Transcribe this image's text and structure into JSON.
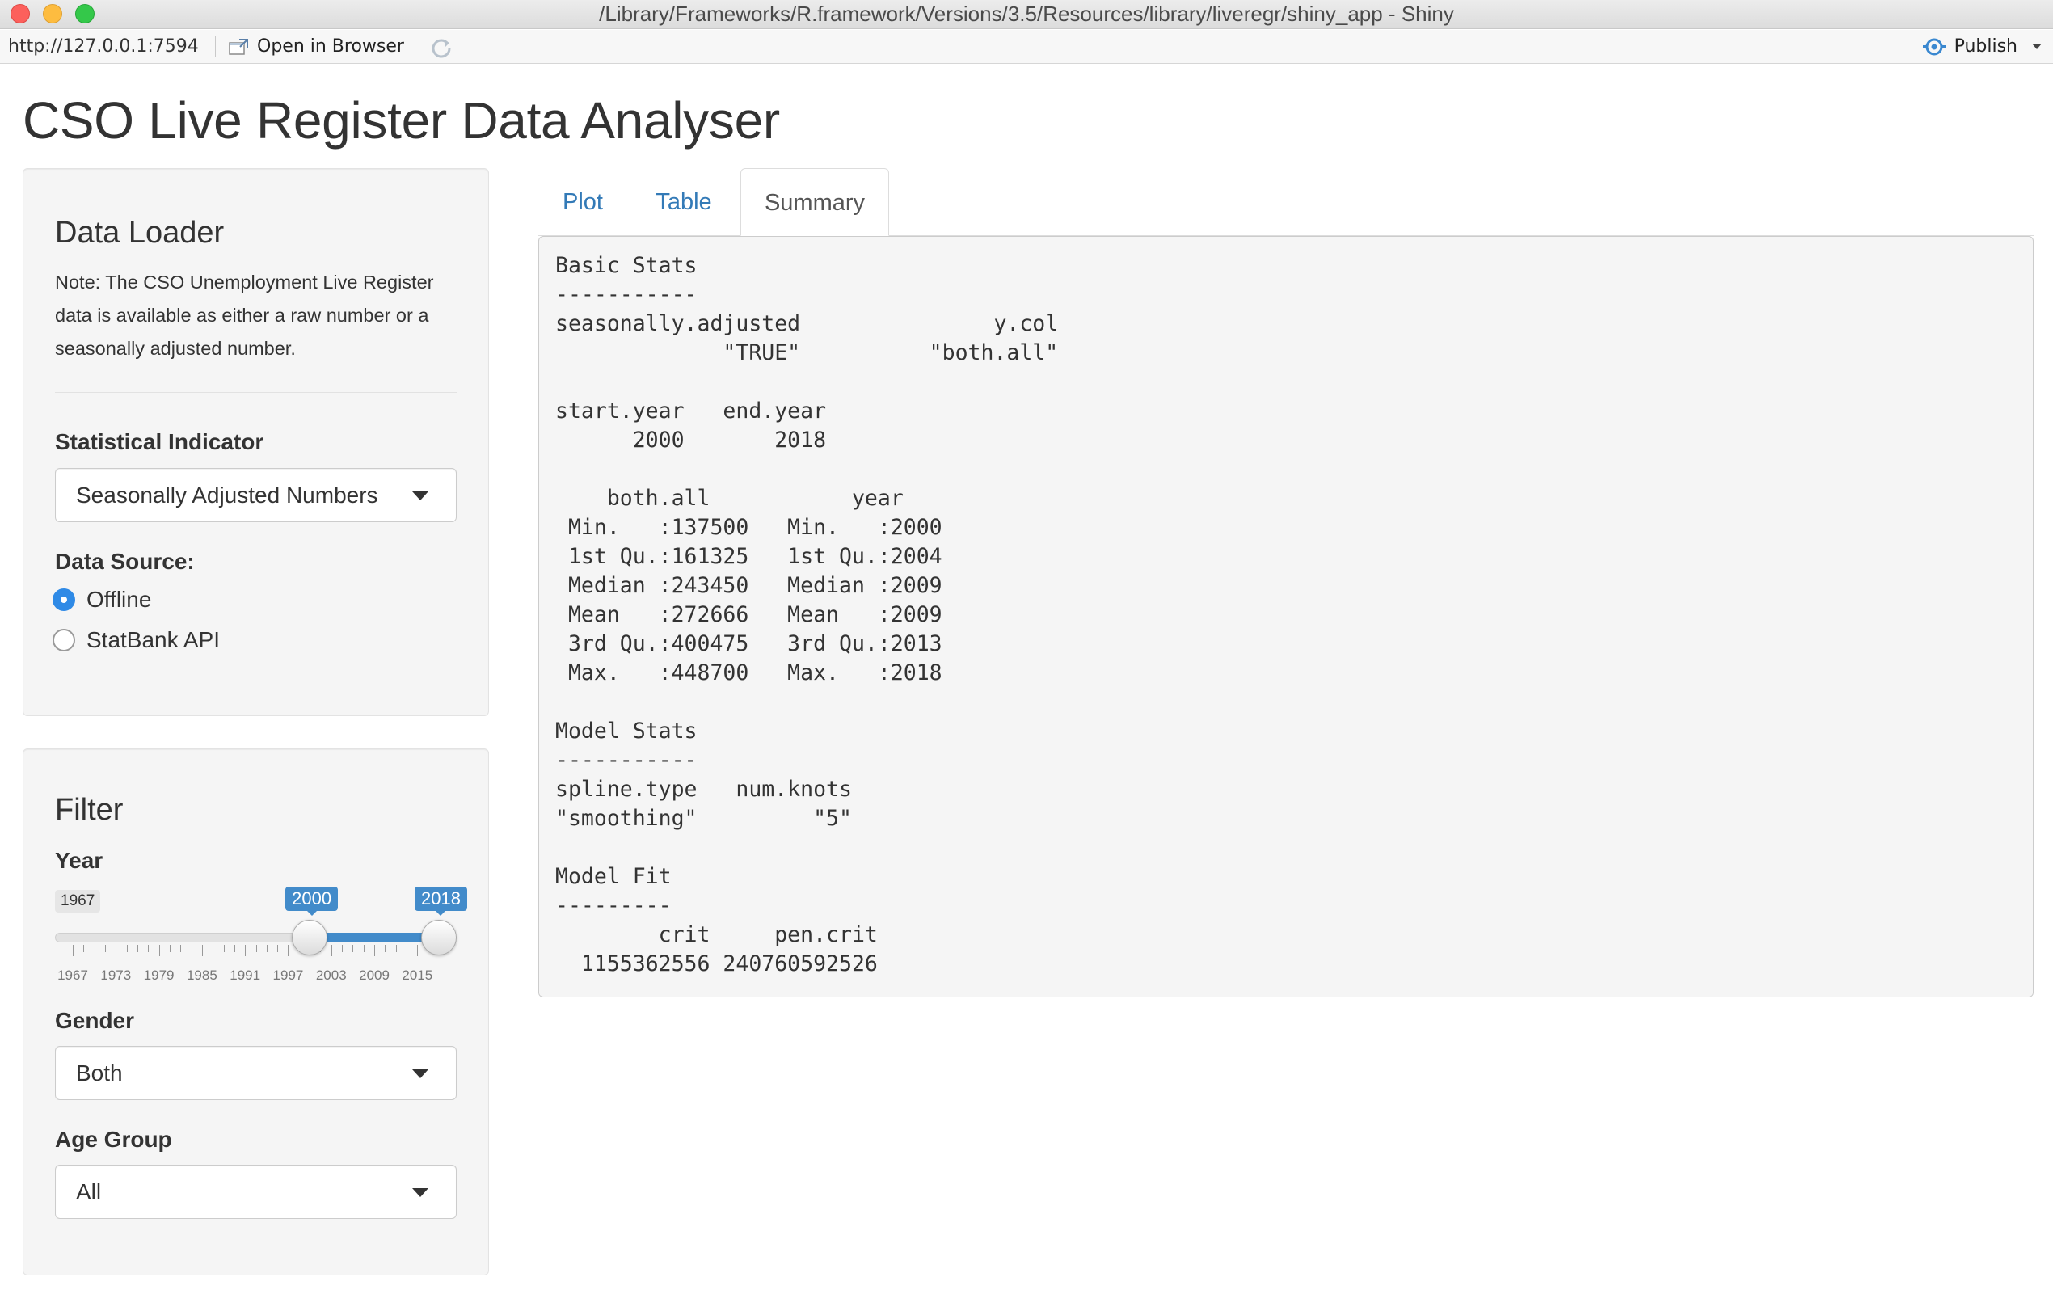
{
  "window": {
    "title": "/Library/Frameworks/R.framework/Versions/3.5/Resources/library/liveregr/shiny_app - Shiny"
  },
  "toolbar": {
    "url": "http://127.0.0.1:7594",
    "open_browser": "Open in Browser",
    "publish": "Publish"
  },
  "page": {
    "title": "CSO Live Register Data Analyser"
  },
  "loader": {
    "heading": "Data Loader",
    "note": "Note: The CSO Unemployment Live Register data is available as either a raw number or a seasonally adjusted number.",
    "indicator_label": "Statistical Indicator",
    "indicator_value": "Seasonally Adjusted Numbers",
    "source_label": "Data Source:",
    "sources": [
      {
        "label": "Offline",
        "checked": true
      },
      {
        "label": "StatBank API",
        "checked": false
      }
    ]
  },
  "filter": {
    "heading": "Filter",
    "year_label": "Year",
    "slider": {
      "min": 1967,
      "max": 2018,
      "from": 2000,
      "to": 2018,
      "min_label": "1967",
      "from_label": "2000",
      "to_label": "2018",
      "tick_labels": [
        "1967",
        "1973",
        "1979",
        "1985",
        "1991",
        "1997",
        "2003",
        "2009",
        "2015"
      ]
    },
    "gender_label": "Gender",
    "gender_value": "Both",
    "age_label": "Age Group",
    "age_value": "All"
  },
  "tabs": [
    {
      "label": "Plot",
      "active": false
    },
    {
      "label": "Table",
      "active": false
    },
    {
      "label": "Summary",
      "active": true
    }
  ],
  "summary": {
    "lines": [
      "Basic Stats",
      "-----------",
      "seasonally.adjusted               y.col",
      "             \"TRUE\"          \"both.all\"",
      "",
      "start.year   end.year",
      "      2000       2018",
      "",
      "    both.all           year",
      " Min.   :137500   Min.   :2000",
      " 1st Qu.:161325   1st Qu.:2004",
      " Median :243450   Median :2009",
      " Mean   :272666   Mean   :2009",
      " 3rd Qu.:400475   3rd Qu.:2013",
      " Max.   :448700   Max.   :2018",
      "",
      "Model Stats",
      "-----------",
      "spline.type   num.knots",
      "\"smoothing\"         \"5\"",
      "",
      "Model Fit",
      "---------",
      "        crit     pen.crit",
      "  1155362556 240760592526"
    ]
  }
}
